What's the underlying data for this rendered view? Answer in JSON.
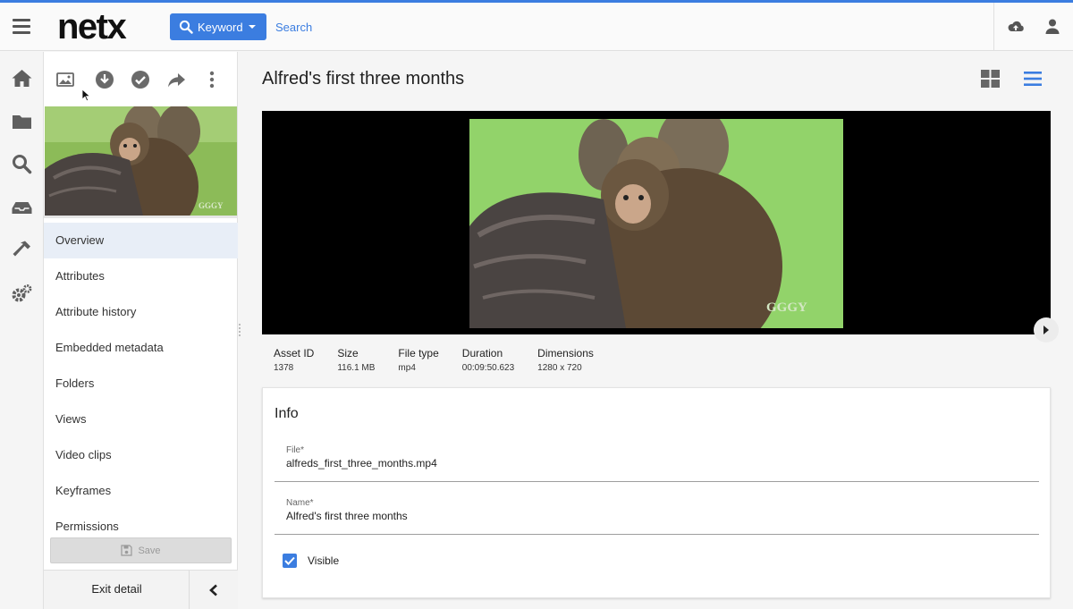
{
  "header": {
    "logo": "netx",
    "keyword_label": "Keyword",
    "search_placeholder": "Search",
    "accent_color": "#3b7de0"
  },
  "rail": {
    "items": [
      "home-icon",
      "folder-icon",
      "search-icon",
      "inbox-icon",
      "hammer-icon",
      "gears-icon"
    ]
  },
  "toolbar": {
    "items": [
      "image-icon",
      "download-icon",
      "check-circle-icon",
      "share-icon",
      "more-vertical-icon"
    ]
  },
  "thumbnail": {
    "watermark": "GGGY"
  },
  "menu": {
    "items": [
      {
        "label": "Overview",
        "active": true
      },
      {
        "label": "Attributes"
      },
      {
        "label": "Attribute history"
      },
      {
        "label": "Embedded metadata"
      },
      {
        "label": "Folders"
      },
      {
        "label": "Views"
      },
      {
        "label": "Video clips"
      },
      {
        "label": "Keyframes"
      },
      {
        "label": "Permissions"
      }
    ]
  },
  "panel": {
    "save_label": "Save",
    "exit_label": "Exit detail"
  },
  "asset": {
    "title": "Alfred's first three months",
    "watermark": "GGGY",
    "meta": [
      {
        "label": "Asset ID",
        "value": "1378"
      },
      {
        "label": "Size",
        "value": "116.1 MB"
      },
      {
        "label": "File type",
        "value": "mp4"
      },
      {
        "label": "Duration",
        "value": "00:09:50.623"
      },
      {
        "label": "Dimensions",
        "value": "1280 x 720"
      }
    ]
  },
  "info": {
    "title": "Info",
    "file_label": "File*",
    "file_value": "alfreds_first_three_months.mp4",
    "name_label": "Name*",
    "name_value": "Alfred's first three months",
    "visible_label": "Visible",
    "visible_checked": true
  }
}
